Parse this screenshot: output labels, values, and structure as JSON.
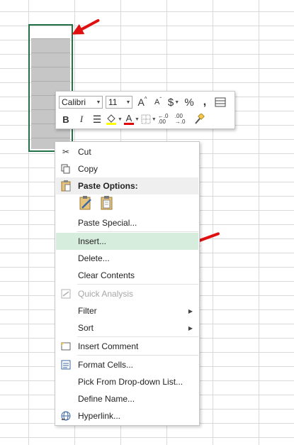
{
  "colors": {
    "selection_border": "#217346",
    "arrow": "#e01010",
    "hover_bg": "#d6ecdd",
    "font_color_bar": "#e00000",
    "highlight_bar": "#ffff00"
  },
  "mini_toolbar": {
    "font_name": "Calibri",
    "font_size": "11",
    "grow_font": "A",
    "shrink_font": "A",
    "currency": "$",
    "percent": "%",
    "comma": ",",
    "bold": "B",
    "italic": "I",
    "font_color_letter": "A",
    "increase_decimal": "←.0 .00",
    "decrease_decimal": ".00 →.0"
  },
  "context_menu": {
    "cut": "Cut",
    "copy": "Copy",
    "paste_options": "Paste Options:",
    "paste_special": "Paste Special...",
    "insert": "Insert...",
    "delete": "Delete...",
    "clear_contents": "Clear Contents",
    "quick_analysis": "Quick Analysis",
    "filter": "Filter",
    "sort": "Sort",
    "insert_comment": "Insert Comment",
    "format_cells": "Format Cells...",
    "pick_from_list": "Pick From Drop-down List...",
    "define_name": "Define Name...",
    "hyperlink": "Hyperlink..."
  }
}
